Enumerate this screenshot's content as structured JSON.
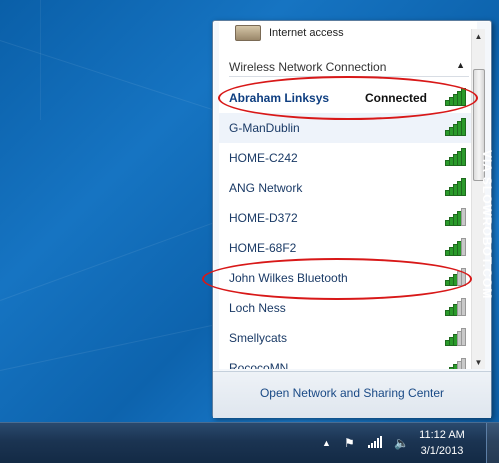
{
  "popup": {
    "internet_access_label": "Internet access",
    "section_title": "Wireless Network Connection",
    "section_caret": "▲",
    "footer_link": "Open Network and Sharing Center",
    "networks": [
      {
        "name": "Abraham Linksys",
        "status": "Connected",
        "signal_bars": 5
      },
      {
        "name": "G-ManDublin",
        "status": "",
        "signal_bars": 5
      },
      {
        "name": "HOME-C242",
        "status": "",
        "signal_bars": 5
      },
      {
        "name": "ANG Network",
        "status": "",
        "signal_bars": 5
      },
      {
        "name": "HOME-D372",
        "status": "",
        "signal_bars": 4
      },
      {
        "name": "HOME-68F2",
        "status": "",
        "signal_bars": 4
      },
      {
        "name": "John Wilkes Bluetooth",
        "status": "",
        "signal_bars": 3
      },
      {
        "name": "Loch Ness",
        "status": "",
        "signal_bars": 3
      },
      {
        "name": "Smellycats",
        "status": "",
        "signal_bars": 3
      },
      {
        "name": "RococoMN",
        "status": "",
        "signal_bars": 3
      }
    ]
  },
  "taskbar": {
    "time": "11:12 AM",
    "date": "3/1/2013",
    "tray_icons": [
      "show-hidden-icons-icon",
      "action-center-flag-icon",
      "network-signal-icon",
      "volume-icon"
    ]
  },
  "watermark": "VIA SLOWROBOT.COM",
  "colors": {
    "signal_on": "#2a9a2a",
    "signal_off": "#c9c9c9",
    "annotation_red": "#d81818",
    "link_blue": "#1a4a86"
  }
}
